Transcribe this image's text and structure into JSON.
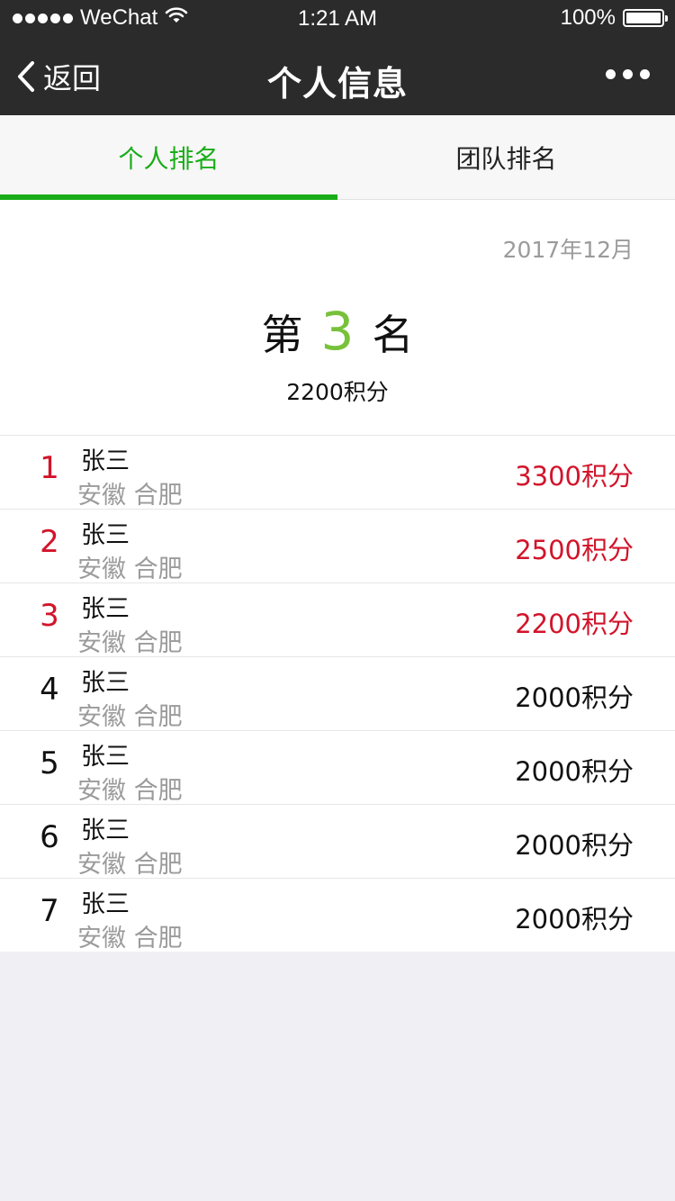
{
  "status_bar": {
    "carrier": "WeChat",
    "time": "1:21 AM",
    "battery": "100%"
  },
  "nav": {
    "back_label": "返回",
    "title": "个人信息"
  },
  "tabs": [
    {
      "label": "个人排名",
      "active": true
    },
    {
      "label": "团队排名",
      "active": false
    }
  ],
  "summary": {
    "date": "2017年12月",
    "rank_prefix": "第",
    "rank": "3",
    "rank_suffix": "名",
    "points": "2200积分"
  },
  "ranking": [
    {
      "rank": "1",
      "name": "张三",
      "location": "安徽 合肥",
      "points": "3300积分"
    },
    {
      "rank": "2",
      "name": "张三",
      "location": "安徽 合肥",
      "points": "2500积分"
    },
    {
      "rank": "3",
      "name": "张三",
      "location": "安徽 合肥",
      "points": "2200积分"
    },
    {
      "rank": "4",
      "name": "张三",
      "location": "安徽 合肥",
      "points": "2000积分"
    },
    {
      "rank": "5",
      "name": "张三",
      "location": "安徽 合肥",
      "points": "2000积分"
    },
    {
      "rank": "6",
      "name": "张三",
      "location": "安徽 合肥",
      "points": "2000积分"
    },
    {
      "rank": "7",
      "name": "张三",
      "location": "安徽 合肥",
      "points": "2000积分"
    }
  ],
  "colors": {
    "accent_green": "#1aad19",
    "rank_green": "#78c13a",
    "top_three_red": "#d2142a",
    "nav_background": "#2b2b2b"
  },
  "icons": {
    "signal": "signal-dots-icon",
    "wifi": "wifi-icon",
    "battery": "battery-icon",
    "back": "chevron-left-icon",
    "more": "more-dots-icon"
  }
}
